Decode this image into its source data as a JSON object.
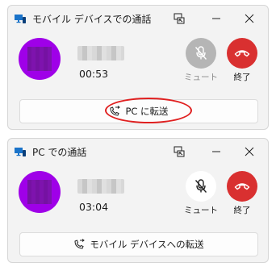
{
  "colors": {
    "accent_purple": "#9f00e8",
    "end_red": "#d93030",
    "highlight_red": "#e02020"
  },
  "windows": [
    {
      "title": "モバイル デバイスでの通話",
      "duration": "00:53",
      "mute_label": "ミュート",
      "mute_state": "disabled",
      "end_label": "終了",
      "transfer_label": "PC に転送",
      "transfer_highlighted": true
    },
    {
      "title": "PC での通話",
      "duration": "03:04",
      "mute_label": "ミュート",
      "mute_state": "enabled",
      "end_label": "終了",
      "transfer_label": "モバイル デバイスへの転送",
      "transfer_highlighted": false
    }
  ],
  "icons": {
    "app": "monitor-phone-icon",
    "compact": "compact-overlay-icon",
    "minimize": "minimize-icon",
    "close": "close-icon",
    "mute": "mic-off-icon",
    "end": "hang-up-icon",
    "transfer": "phone-transfer-icon"
  }
}
